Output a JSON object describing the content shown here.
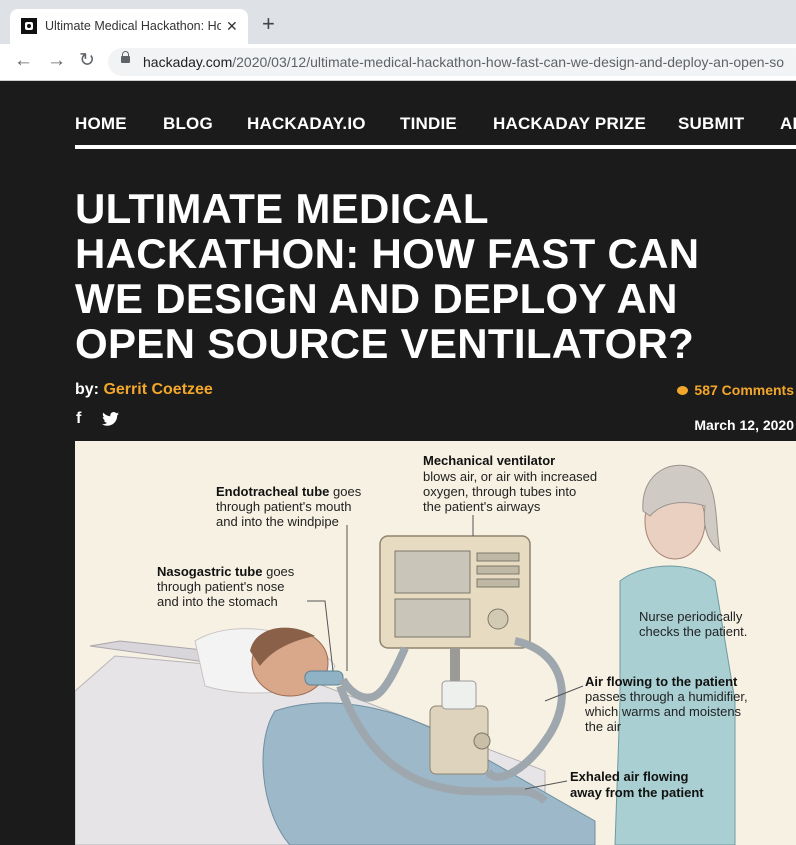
{
  "browser": {
    "tab_title": "Ultimate Medical Hackathon: How",
    "tab_close": "✕",
    "new_tab": "+",
    "url_host": "hackaday.com",
    "url_path": "/2020/03/12/ultimate-medical-hackathon-how-fast-can-we-design-and-deploy-an-open-so"
  },
  "site_nav": [
    "HOME",
    "BLOG",
    "HACKADAY.IO",
    "TINDIE",
    "HACKADAY PRIZE",
    "SUBMIT",
    "AB"
  ],
  "article": {
    "title": "Ultimate Medical Hackathon: How Fast Can We Design and Deploy an Open Source Ventilator?",
    "by_label": "by:",
    "author": "Gerrit Coetzee",
    "comments": "587 Comments",
    "share_facebook": "f",
    "date": "March 12, 2020"
  },
  "figure": {
    "mech_title": "Mechanical ventilator",
    "mech_l1": "blows air, or air with increased",
    "mech_l2": "oxygen, through tubes into",
    "mech_l3": "the patient's airways",
    "endo_title": "Endotracheal tube",
    "endo_l1_rest": " goes",
    "endo_l2": "through patient's mouth",
    "endo_l3": "and into the windpipe",
    "naso_title": "Nasogastric tube",
    "naso_l1_rest": " goes",
    "naso_l2": "through patient's nose",
    "naso_l3": "and into the stomach",
    "nurse_l1": "Nurse periodically",
    "nurse_l2": "checks the patient.",
    "air_title": "Air flowing to the patient",
    "air_l1": "passes through a humidifier,",
    "air_l2": "which warms and moistens",
    "air_l3": "the air",
    "exh_l1": "Exhaled air flowing",
    "exh_l2": "away from the patient"
  }
}
